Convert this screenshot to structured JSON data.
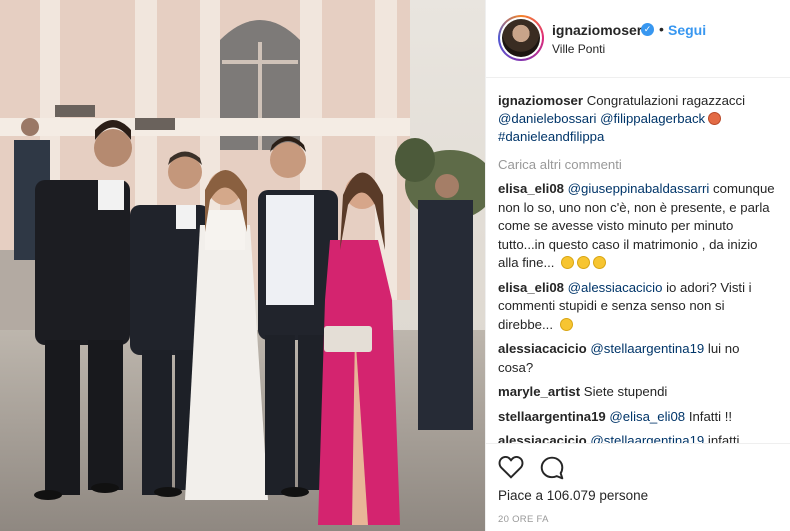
{
  "post": {
    "username": "ignaziomoser",
    "verified": true,
    "separator": "•",
    "follow_label": "Segui",
    "location": "Ville Ponti"
  },
  "caption": {
    "username": "ignaziomoser",
    "text": "Congratulazioni ragazzacci",
    "mention_1": "@danielebossari",
    "mention_2": "@filippalagerback",
    "hashtag": "#danieleandfilippa"
  },
  "load_more_label": "Carica altri commenti",
  "comments": [
    {
      "username": "elisa_eli08",
      "mention": "@giuseppinabaldassarri",
      "text": "comunque non lo so, uno non c'è, non è presente, e parla come se avesse visto minuto per minuto tutto...in questo caso il matrimonio , da inizio alla fine..."
    },
    {
      "username": "elisa_eli08",
      "mention": "@alessiacacicio",
      "text": "io adori? Visti i commenti stupidi e senza senso non si direbbe..."
    },
    {
      "username": "alessiacacicio",
      "mention": "@stellaargentina19",
      "text": "lui no cosa?"
    },
    {
      "username": "maryle_artist",
      "text": "Siete stupendi"
    },
    {
      "username": "stellaargentina19",
      "mention": "@elisa_eli08",
      "text": "Infatti !!"
    },
    {
      "username": "alessiacacicio",
      "mention": "@stellaargentina19",
      "text": "infatti,"
    }
  ],
  "actions": {
    "like_icon": "heart-icon",
    "comment_icon": "speech-bubble-icon",
    "likes_text": "Piace a 106.079 persone",
    "time": "20 ORE FA"
  },
  "colors": {
    "link": "#3897f0",
    "mention": "#003569",
    "dress": "#d4246f"
  }
}
